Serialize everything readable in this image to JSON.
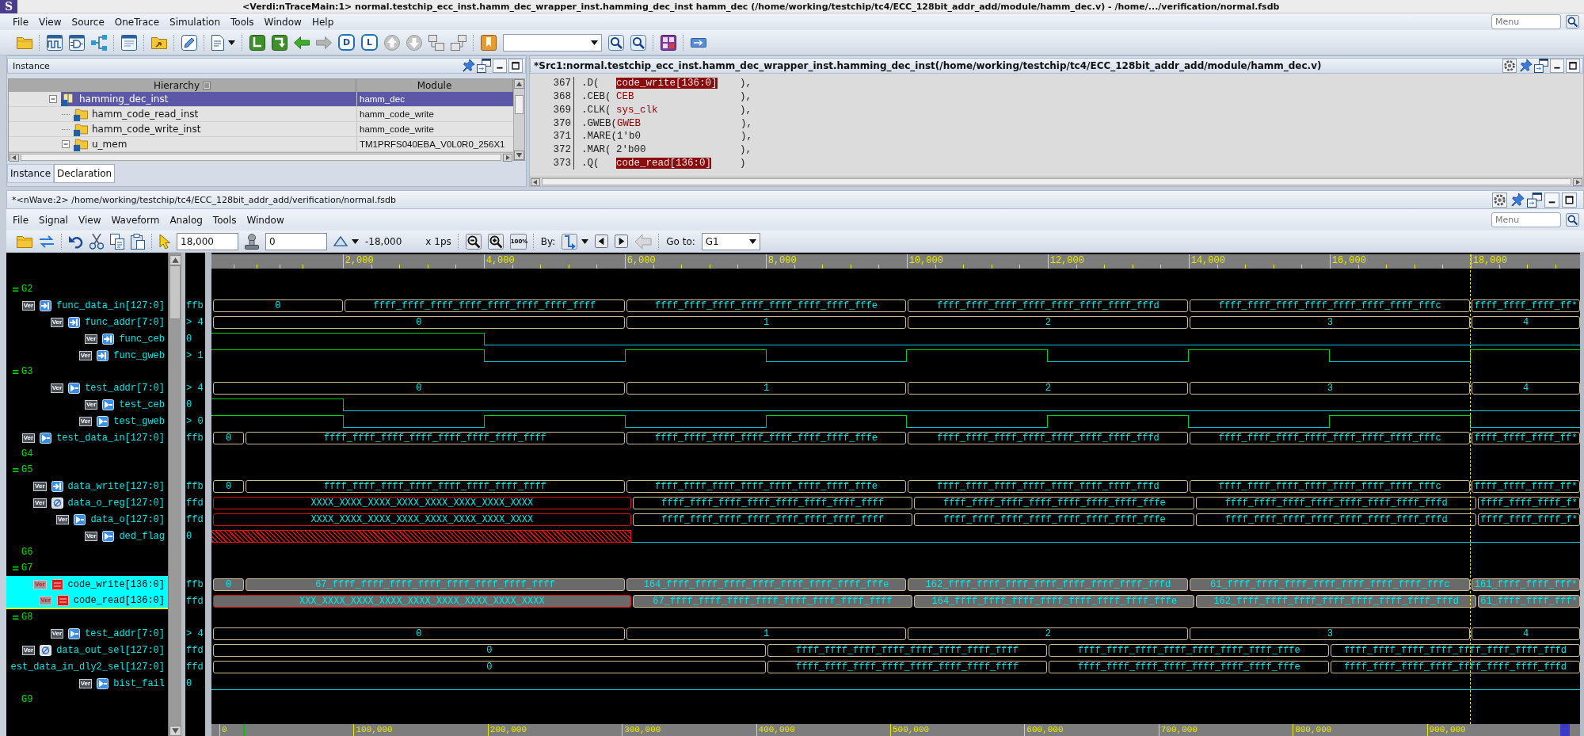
{
  "app": {
    "logo": "S",
    "title": "<Verdi:nTraceMain:1> normal.testchip_ecc_inst.hamm_dec_wrapper_inst.hamming_dec_inst hamm_dec (/home/working/testchip/tc4/ECC_128bit_addr_add/module/hamm_dec.v) - /home/.../verification/normal.fsdb"
  },
  "menu": {
    "items": [
      "File",
      "View",
      "Source",
      "OneTrace",
      "Simulation",
      "Tools",
      "Window",
      "Help"
    ],
    "search": {
      "placeholder": "Menu"
    }
  },
  "toolbar": {
    "tile_buttons": [
      "D",
      "L"
    ]
  },
  "instance_panel": {
    "title": "Instance",
    "columns": [
      "Hierarchy",
      "Module"
    ],
    "tree": [
      {
        "name": "hamming_dec_inst",
        "module": "hamm_dec",
        "kind": "open_scope",
        "expanded": true,
        "selected": true,
        "children": [
          {
            "name": "hamm_code_read_inst",
            "module": "hamm_code_write",
            "kind": "instance",
            "selected": false
          },
          {
            "name": "hamm_code_write_inst",
            "module": "hamm_code_write",
            "kind": "instance",
            "selected": false
          },
          {
            "name": "u_mem",
            "module": "TM1PRFS040EBA_V0L0R0_256X1",
            "kind": "instance",
            "expanded": true,
            "selected": false
          }
        ]
      }
    ],
    "tabs": [
      {
        "label": "Instance",
        "selected": true
      },
      {
        "label": "Declaration",
        "selected": false
      }
    ]
  },
  "source_panel": {
    "title": "*Src1:normal.testchip_ecc_inst.hamm_dec_wrapper_inst.hamming_dec_inst(/home/working/testchip/tc4/ECC_128bit_addr_add/module/hamm_dec.v)",
    "lines": [
      {
        "number": "367",
        "call": ".D(",
        "arg": "code_write[136:0]",
        "kind": "highlight",
        "close": "),"
      },
      {
        "number": "368",
        "call": ".CEB(",
        "arg": "CEB",
        "kind": "signal",
        "close": "),"
      },
      {
        "number": "369",
        "call": ".CLK(",
        "arg": "sys_clk",
        "kind": "signal",
        "close": "),"
      },
      {
        "number": "370",
        "call": ".GWEB(",
        "arg": "GWEB",
        "kind": "signal",
        "close": "),"
      },
      {
        "number": "371",
        "call": ".MARE(",
        "arg": "1'b0",
        "kind": "literal",
        "close": "),"
      },
      {
        "number": "372",
        "call": ".MAR(",
        "arg": "2'b00",
        "kind": "literal",
        "close": "),"
      },
      {
        "number": "373",
        "call": ".Q(",
        "arg": "code_read[136:0]",
        "kind": "highlight",
        "close": ")"
      }
    ]
  },
  "nwave": {
    "title": "*<nWave:2> /home/working/testchip/tc4/ECC_128bit_addr_add/verification/normal.fsdb",
    "menu": {
      "items": [
        "File",
        "Signal",
        "View",
        "Waveform",
        "Analog",
        "Tools",
        "Window"
      ],
      "search": {
        "placeholder": "Menu"
      }
    },
    "toolbar": {
      "cursor_time": "18,000",
      "marker_time": "0",
      "delta": "-18,000",
      "unit": "x 1ps",
      "zoom_full": "100%",
      "by_label": "By:",
      "goto_label": "Go to:",
      "goto_value": "G1"
    },
    "ruler": {
      "ticks": [
        "2,000",
        "4,000",
        "6,000",
        "8,000",
        "10,000",
        "12,000",
        "14,000",
        "16,000",
        "18,000"
      ]
    },
    "signal_groups": [
      {
        "name": "G2",
        "expanded": true,
        "signals": [
          {
            "name": "func_data_in[127:0]",
            "badge": "Ver",
            "kind": "input",
            "value": "ffb",
            "selected": false,
            "segments": [
              {
                "label": "0",
                "unknown": false
              },
              {
                "label": "ffff_ffff_ffff_ffff_ffff_ffff_ffff_ffff",
                "unknown": false
              },
              {
                "label": "ffff_ffff_ffff_ffff_ffff_ffff_ffff_fffe",
                "unknown": false
              },
              {
                "label": "ffff_ffff_ffff_ffff_ffff_ffff_ffff_fffd",
                "unknown": false
              },
              {
                "label": "ffff_ffff_ffff_ffff_ffff_ffff_ffff_fffc",
                "unknown": false
              },
              {
                "label": "ffff_ffff_ffff_ff*",
                "unknown": false
              }
            ]
          },
          {
            "name": "func_addr[7:0]",
            "badge": "Ver",
            "kind": "input",
            "value": "> 4",
            "selected": false,
            "segments": [
              {
                "label": "0",
                "unknown": false
              },
              {
                "label": "1",
                "unknown": false
              },
              {
                "label": "2",
                "unknown": false
              },
              {
                "label": "3",
                "unknown": false
              },
              {
                "label": "4",
                "unknown": false
              }
            ]
          },
          {
            "name": "func_ceb",
            "badge": "Ver",
            "kind": "input",
            "value": "0",
            "selected": false,
            "segments": [
              {
                "high": true,
                "unknown": false
              },
              {
                "high": false,
                "unknown": false
              }
            ]
          },
          {
            "name": "func_gweb",
            "badge": "Ver",
            "kind": "input",
            "value": "> 1",
            "selected": false,
            "segments": [
              {
                "high": true,
                "unknown": false
              },
              {
                "high": false,
                "unknown": false
              },
              {
                "high": true,
                "unknown": false
              },
              {
                "high": false,
                "unknown": false
              },
              {
                "high": true,
                "unknown": false
              },
              {
                "high": false,
                "unknown": false
              },
              {
                "high": true,
                "unknown": false
              },
              {
                "high": false,
                "unknown": false
              },
              {
                "high": true,
                "unknown": false
              }
            ]
          }
        ]
      },
      {
        "name": "G3",
        "expanded": true,
        "signals": [
          {
            "name": "test_addr[7:0]",
            "badge": "Ver",
            "kind": "output",
            "value": "> 4",
            "selected": false,
            "segments": [
              {
                "label": "0",
                "unknown": false
              },
              {
                "label": "1",
                "unknown": false
              },
              {
                "label": "2",
                "unknown": false
              },
              {
                "label": "3",
                "unknown": false
              },
              {
                "label": "4",
                "unknown": false
              }
            ]
          },
          {
            "name": "test_ceb",
            "badge": "Ver",
            "kind": "output",
            "value": "0",
            "selected": false,
            "segments": [
              {
                "high": true,
                "unknown": false
              },
              {
                "high": false,
                "unknown": false
              }
            ]
          },
          {
            "name": "test_gweb",
            "badge": "Ver",
            "kind": "output",
            "value": "> 0",
            "selected": false,
            "segments": [
              {
                "high": true,
                "unknown": false
              },
              {
                "high": false,
                "unknown": false
              },
              {
                "high": true,
                "unknown": false
              },
              {
                "high": false,
                "unknown": false
              },
              {
                "high": true,
                "unknown": false
              },
              {
                "high": false,
                "unknown": false
              },
              {
                "high": true,
                "unknown": false
              },
              {
                "high": false,
                "unknown": false
              },
              {
                "high": true,
                "unknown": false
              },
              {
                "high": false,
                "unknown": false
              }
            ]
          },
          {
            "name": "test_data_in[127:0]",
            "badge": "Ver",
            "kind": "output",
            "value": "ffb",
            "selected": false,
            "segments": [
              {
                "label": "0",
                "unknown": false
              },
              {
                "label": "ffff_ffff_ffff_ffff_ffff_ffff_ffff_ffff",
                "unknown": false
              },
              {
                "label": "ffff_ffff_ffff_ffff_ffff_ffff_ffff_fffe",
                "unknown": false
              },
              {
                "label": "ffff_ffff_ffff_ffff_ffff_ffff_ffff_fffd",
                "unknown": false
              },
              {
                "label": "ffff_ffff_ffff_ffff_ffff_ffff_ffff_fffc",
                "unknown": false
              },
              {
                "label": "ffff_ffff_ffff_ff*",
                "unknown": false
              }
            ]
          }
        ]
      },
      {
        "name": "G4",
        "expanded": false
      },
      {
        "name": "G5",
        "expanded": true,
        "signals": [
          {
            "name": "data_write[127:0]",
            "badge": "Ver",
            "kind": "input",
            "value": "ffb",
            "selected": false,
            "segments": [
              {
                "label": "0",
                "unknown": false
              },
              {
                "label": "ffff_ffff_ffff_ffff_ffff_ffff_ffff_ffff",
                "unknown": false
              },
              {
                "label": "ffff_ffff_ffff_ffff_ffff_ffff_ffff_fffe",
                "unknown": false
              },
              {
                "label": "ffff_ffff_ffff_ffff_ffff_ffff_ffff_fffd",
                "unknown": false
              },
              {
                "label": "ffff_ffff_ffff_ffff_ffff_ffff_ffff_fffc",
                "unknown": false
              },
              {
                "label": "ffff_ffff_ffff_ff*",
                "unknown": false
              }
            ]
          },
          {
            "name": "data_o_reg[127:0]",
            "badge": "Ver",
            "kind": "register",
            "value": "ffd",
            "selected": false,
            "segments": [
              {
                "label": "XXXX_XXXX_XXXX_XXXX_XXXX_XXXX_XXXX_XXXX",
                "unknown": true
              },
              {
                "label": "ffff_ffff_ffff_ffff_ffff_ffff_ffff_ffff",
                "unknown": false
              },
              {
                "label": "ffff_ffff_ffff_ffff_ffff_ffff_ffff_fffe",
                "unknown": false
              },
              {
                "label": "ffff_ffff_ffff_ffff_ffff_ffff_ffff_fffd",
                "unknown": false
              },
              {
                "label": "ffff_ffff_ffff_f*",
                "unknown": false
              }
            ]
          },
          {
            "name": "data_o[127:0]",
            "badge": "Ver",
            "kind": "output",
            "value": "ffd",
            "selected": false,
            "segments": [
              {
                "label": "XXXX_XXXX_XXXX_XXXX_XXXX_XXXX_XXXX_XXXX",
                "unknown": true
              },
              {
                "label": "ffff_ffff_ffff_ffff_ffff_ffff_ffff_ffff",
                "unknown": false
              },
              {
                "label": "ffff_ffff_ffff_ffff_ffff_ffff_ffff_fffe",
                "unknown": false
              },
              {
                "label": "ffff_ffff_ffff_ffff_ffff_ffff_ffff_fffd",
                "unknown": false
              },
              {
                "label": "ffff_ffff_ffff_f*",
                "unknown": false
              }
            ]
          },
          {
            "name": "ded_flag",
            "badge": "Ver",
            "kind": "output",
            "value": "0",
            "selected": false,
            "segments": [
              {
                "unknown": true
              },
              {
                "high": false,
                "unknown": false
              }
            ]
          }
        ]
      },
      {
        "name": "G6",
        "expanded": false
      },
      {
        "name": "G7",
        "expanded": true,
        "signals": [
          {
            "name": "code_write[136:0]",
            "badge": "Ver",
            "kind": "wire",
            "value": "ffb",
            "selected": true,
            "segments": [
              {
                "label": "0",
                "unknown": false
              },
              {
                "label": "67_ffff_ffff_ffff_ffff_ffff_ffff_ffff_ffff",
                "unknown": false
              },
              {
                "label": "164_ffff_ffff_ffff_ffff_ffff_ffff_ffff_fffe",
                "unknown": false
              },
              {
                "label": "162_ffff_ffff_ffff_ffff_ffff_ffff_ffff_fffd",
                "unknown": false
              },
              {
                "label": "61_ffff_ffff_ffff_ffff_ffff_ffff_ffff_fffc",
                "unknown": false
              },
              {
                "label": "161_ffff_ffff_fff*",
                "unknown": false
              }
            ]
          },
          {
            "name": "code_read[136:0]",
            "badge": "Ver",
            "kind": "wire",
            "value": "ffd",
            "selected": true,
            "insertion_point": true,
            "segments": [
              {
                "label": "XXX_XXXX_XXXX_XXXX_XXXX_XXXX_XXXX_XXXX_XXXX",
                "unknown": true
              },
              {
                "label": "67_ffff_ffff_ffff_ffff_ffff_ffff_ffff_ffff",
                "unknown": false
              },
              {
                "label": "164_ffff_ffff_ffff_ffff_ffff_ffff_ffff_fffe",
                "unknown": false
              },
              {
                "label": "162_ffff_ffff_ffff_ffff_ffff_ffff_ffff_fffd",
                "unknown": false
              },
              {
                "label": "61_ffff_ffff_fff*",
                "unknown": false
              }
            ]
          }
        ]
      },
      {
        "name": "G8",
        "expanded": true,
        "signals": [
          {
            "name": "test_addr[7:0]",
            "badge": "Ver",
            "kind": "output",
            "value": "> 4",
            "selected": false,
            "segments": [
              {
                "label": "0",
                "unknown": false
              },
              {
                "label": "1",
                "unknown": false
              },
              {
                "label": "2",
                "unknown": false
              },
              {
                "label": "3",
                "unknown": false
              },
              {
                "label": "4",
                "unknown": false
              }
            ]
          },
          {
            "name": "data_out_sel[127:0]",
            "badge": "Ver",
            "kind": "register",
            "value": "ffd",
            "selected": false,
            "segments": [
              {
                "label": "0",
                "unknown": false
              },
              {
                "label": "ffff_ffff_ffff_ffff_ffff_ffff_ffff_ffff",
                "unknown": false
              },
              {
                "label": "ffff_ffff_ffff_ffff_ffff_ffff_ffff_fffe",
                "unknown": false
              },
              {
                "label": "ffff_ffff_ffff_ffff_ffff_ffff_ffff_fffd",
                "unknown": false
              }
            ]
          },
          {
            "name": "est_data_in_dly2_sel[127:0]",
            "value": "ffd",
            "selected": false,
            "segments": [
              {
                "label": "0",
                "unknown": false
              },
              {
                "label": "ffff_ffff_ffff_ffff_ffff_ffff_ffff_ffff",
                "unknown": false
              },
              {
                "label": "ffff_ffff_ffff_ffff_ffff_ffff_ffff_fffe",
                "unknown": false
              },
              {
                "label": "ffff_ffff_ffff_ffff_ffff_ffff_ffff_fffd",
                "unknown": false
              }
            ]
          },
          {
            "name": "bist_fail",
            "badge": "Ver",
            "kind": "output",
            "value": "0",
            "selected": false,
            "segments": [
              {
                "high": false,
                "unknown": false
              }
            ]
          }
        ]
      },
      {
        "name": "G9",
        "expanded": false
      }
    ],
    "overview": {
      "ticks": [
        "0",
        "100,000",
        "200,000",
        "300,000",
        "400,000",
        "500,000",
        "600,000",
        "700,000",
        "800,000",
        "900,000"
      ]
    }
  }
}
